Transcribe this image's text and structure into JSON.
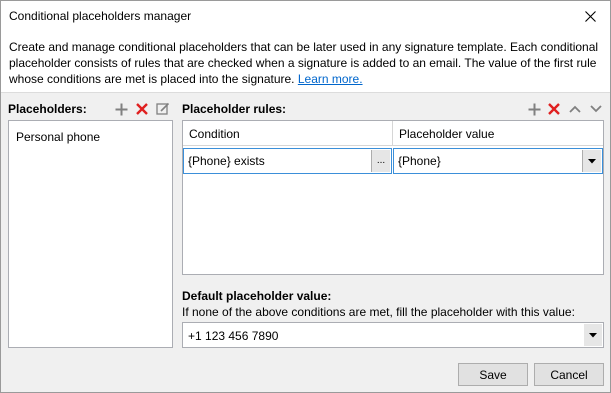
{
  "window": {
    "title": "Conditional placeholders manager"
  },
  "description": {
    "text": "Create and manage conditional placeholders that can be later used in any signature template. Each conditional placeholder consists of rules that are checked when a signature is added to an email. The value of the first rule whose conditions are met is placed into the signature.",
    "link_label": "Learn more."
  },
  "placeholders": {
    "label": "Placeholders:",
    "items": [
      "Personal phone"
    ]
  },
  "rules": {
    "label": "Placeholder rules:",
    "columns": [
      "Condition",
      "Placeholder value"
    ],
    "rows": [
      {
        "condition": "{Phone} exists",
        "value": "{Phone}"
      }
    ],
    "ellipsis_label": "..."
  },
  "default_value": {
    "label": "Default placeholder value:",
    "hint": "If none of the above conditions are met, fill the placeholder with this value:",
    "value": "+1 123 456 7890"
  },
  "buttons": {
    "save": "Save",
    "cancel": "Cancel"
  },
  "colors": {
    "add": "#808080",
    "delete": "#e02020",
    "link": "#0066cc",
    "focus_border": "#3b8fd9"
  },
  "icons": [
    "close-icon",
    "plus-icon",
    "delete-x-icon",
    "edit-icon",
    "arrow-up-icon",
    "arrow-down-icon",
    "dropdown-arrow-icon"
  ]
}
